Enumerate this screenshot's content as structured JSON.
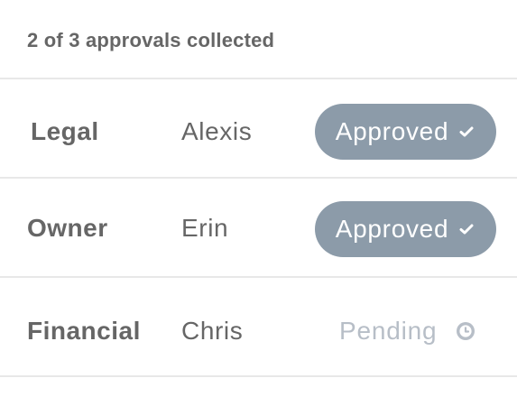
{
  "summary": "2 of 3 approvals collected",
  "rows": [
    {
      "role": "Legal",
      "person": "Alexis",
      "status": "Approved",
      "status_icon": "check-icon"
    },
    {
      "role": "Owner",
      "person": "Erin",
      "status": "Approved",
      "status_icon": "check-icon"
    },
    {
      "role": "Financial",
      "person": "Chris",
      "status": "Pending",
      "status_icon": "clock-icon"
    }
  ],
  "colors": {
    "approved_badge": "#8c9ba9",
    "approved_text": "#ffffff",
    "pending_text": "#b7bec7",
    "label_text": "#666666",
    "divider": "#e8e8e8"
  }
}
